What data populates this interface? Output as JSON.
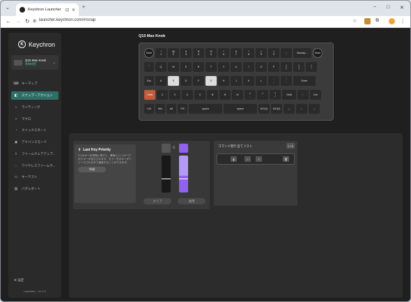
{
  "browser": {
    "tab_title": "Keychron Launcher",
    "url": "launcher.keychron.com/#/snap",
    "new_tab_glyph": "+",
    "window_controls": [
      "−",
      "□",
      "✕"
    ]
  },
  "sidebar": {
    "brand": "Keychron",
    "device_name": "Q15 Max Knob",
    "device_status": "有線接続",
    "items": [
      {
        "label": "キーマップ",
        "icon": "keyboard-icon"
      },
      {
        "label": "スナップ・アクション",
        "icon": "snap-icon",
        "active": true
      },
      {
        "label": "ライティング",
        "icon": "lighting-icon"
      },
      {
        "label": "マクロ",
        "icon": "macro-icon"
      },
      {
        "label": "クイックスタート",
        "icon": "quickstart-icon"
      },
      {
        "label": "アドバンスモード",
        "icon": "advance-icon"
      },
      {
        "label": "ファームウェアアップ...",
        "icon": "firmware-icon"
      },
      {
        "label": "ワイヤレスファームウ...",
        "icon": "wireless-icon"
      },
      {
        "label": "キーテスト",
        "icon": "keytest-icon"
      },
      {
        "label": "バグレポート",
        "icon": "bug-icon"
      }
    ],
    "settings_label": "設定",
    "version": "Launcher - V1.2.2"
  },
  "main": {
    "device_title": "Q15 Max Knob",
    "keyboard_rows": [
      [
        "Mute",
        "!\n1",
        "@\n2",
        "#\n3",
        "$\n4",
        "%\n5",
        "^\n6",
        "&\n7",
        "*\n8",
        "(\n9",
        ")\n0",
        "_\n-",
        "Backsp...",
        "Mute"
      ],
      [
        "~\n`",
        "Q",
        "W",
        "E",
        "R",
        "T",
        "Y",
        "U",
        "I",
        "O",
        "P",
        "{\n[",
        "}\n]",
        "|\n\\"
      ],
      [
        "Esc",
        "A",
        "S",
        "D",
        "F",
        "G",
        "H",
        "J",
        "K",
        "L",
        ":\n;",
        "\"\n'",
        "Enter"
      ],
      [
        "Shift",
        "Z",
        "X",
        "C",
        "V",
        "B",
        "N",
        "M",
        "<\n,",
        ">\n.",
        "?\n/",
        "Shift",
        "↑",
        "Del"
      ],
      [
        "Ctrl",
        "Win",
        "Alt",
        "FN",
        "space",
        "space",
        "MO(1)",
        "MO(2)",
        "←",
        "↓",
        "→"
      ]
    ]
  },
  "snap": {
    "title": "Last Key Priority",
    "description": "2つのキーを同時に押すと、最後にトリガーされたキーが出力されます。もう一方のキーがリリースされるまで保留することができます。",
    "create_button": "作成",
    "clear_button": "クリア",
    "apply_button": "適用",
    "separator": "Ⅽ",
    "left_bar_level": 0.35,
    "right_bar_level": 1.0,
    "right_marker_level": 0.35,
    "colors": {
      "accent": "#8f62f0",
      "accent_light": "#b49af7",
      "gray": "#555555"
    }
  },
  "command_list": {
    "title": "コマンド割り当てリスト",
    "count": "1 / 5",
    "button_glyphs": [
      "▮",
      "+",
      "+",
      "🗑"
    ]
  }
}
